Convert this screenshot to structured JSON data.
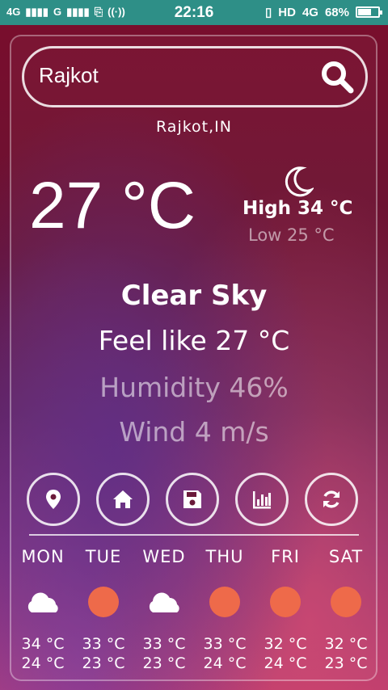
{
  "status_bar": {
    "signal1": "4G",
    "signal2": "G",
    "time": "22:16",
    "hd": "HD",
    "net": "4G",
    "battery": "68%",
    "battery_level": 0.68
  },
  "search": {
    "value": "Rajkot",
    "icon": "search-icon"
  },
  "location": "Rajkot,IN",
  "current": {
    "temperature": "27 °C",
    "icon": "moon-icon",
    "high": "High 34 °C",
    "low": "Low 25 °C",
    "description": "Clear Sky",
    "feels_like": "Feel like 27 °C",
    "humidity": "Humidity 46%",
    "wind": "Wind 4 m/s"
  },
  "actions": [
    {
      "name": "location-button",
      "icon": "map-pin-icon"
    },
    {
      "name": "home-button",
      "icon": "home-icon"
    },
    {
      "name": "save-button",
      "icon": "floppy-disk-icon"
    },
    {
      "name": "chart-button",
      "icon": "bar-chart-icon"
    },
    {
      "name": "refresh-button",
      "icon": "refresh-icon"
    }
  ],
  "forecast": [
    {
      "day": "MON",
      "icon": "cloud-icon",
      "high": "34 °C",
      "low": "24 °C"
    },
    {
      "day": "TUE",
      "icon": "sun-icon",
      "high": "33 °C",
      "low": "23 °C"
    },
    {
      "day": "WED",
      "icon": "cloud-icon",
      "high": "33 °C",
      "low": "23 °C"
    },
    {
      "day": "THU",
      "icon": "sun-icon",
      "high": "33 °C",
      "low": "24 °C"
    },
    {
      "day": "FRI",
      "icon": "sun-icon",
      "high": "32 °C",
      "low": "24 °C"
    },
    {
      "day": "SAT",
      "icon": "sun-icon",
      "high": "32 °C",
      "low": "23 °C"
    }
  ],
  "colors": {
    "status_bar": "#2e8f87",
    "sun": "#ee6a4a",
    "cloud": "#ffffff"
  }
}
